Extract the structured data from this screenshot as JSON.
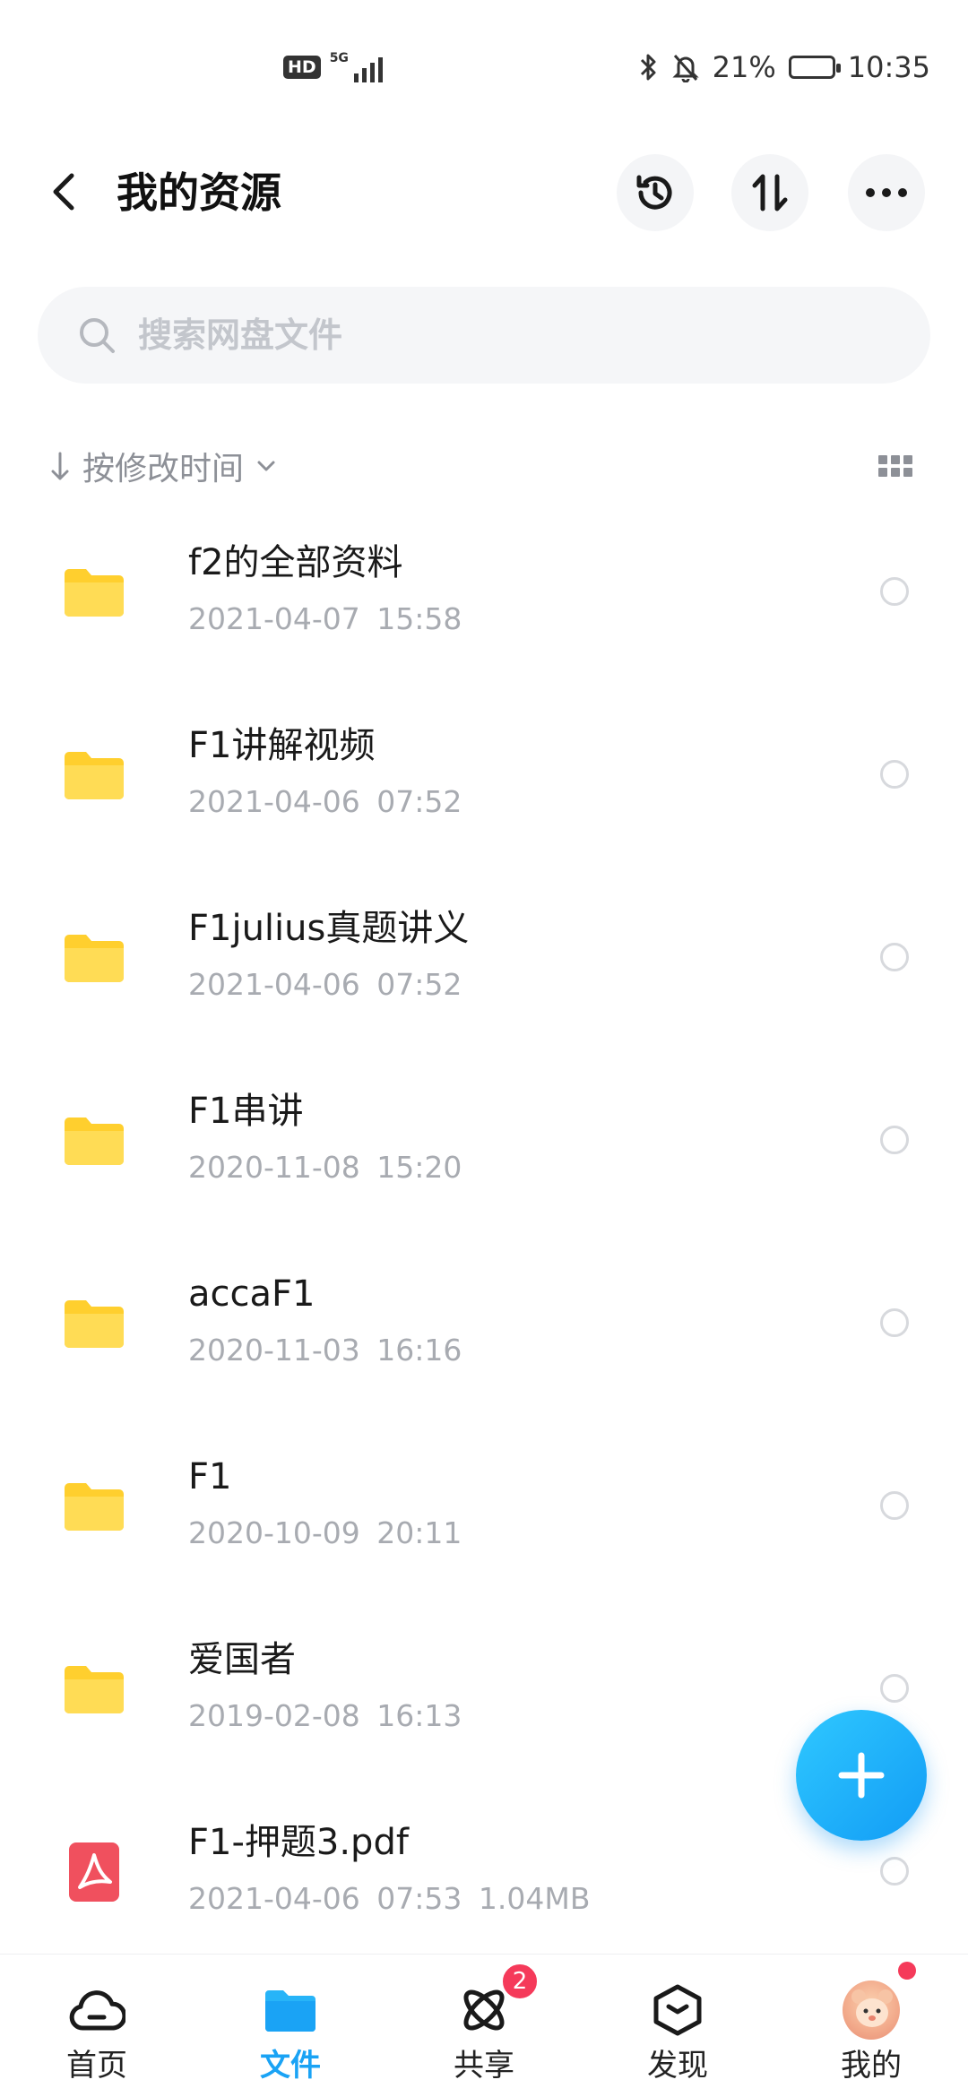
{
  "status_bar": {
    "hd": "HD",
    "network": "5G",
    "battery_percent": "21%",
    "battery_level": 0.21,
    "time": "10:35"
  },
  "header": {
    "title": "我的资源",
    "icons": [
      "back-icon",
      "history-icon",
      "sort-icon",
      "more-icon"
    ]
  },
  "search": {
    "placeholder": "搜索网盘文件"
  },
  "sort": {
    "label": "按修改时间"
  },
  "files": [
    {
      "name": "f2的全部资料",
      "date": "2021-04-07",
      "time": "15:58",
      "size": "",
      "type": "folder"
    },
    {
      "name": "F1讲解视频",
      "date": "2021-04-06",
      "time": "07:52",
      "size": "",
      "type": "folder"
    },
    {
      "name": "F1julius真题讲义",
      "date": "2021-04-06",
      "time": "07:52",
      "size": "",
      "type": "folder"
    },
    {
      "name": "F1串讲",
      "date": "2020-11-08",
      "time": "15:20",
      "size": "",
      "type": "folder"
    },
    {
      "name": "accaF1",
      "date": "2020-11-03",
      "time": "16:16",
      "size": "",
      "type": "folder"
    },
    {
      "name": "F1",
      "date": "2020-10-09",
      "time": "20:11",
      "size": "",
      "type": "folder"
    },
    {
      "name": "爱国者",
      "date": "2019-02-08",
      "time": "16:13",
      "size": "",
      "type": "folder"
    },
    {
      "name": "F1-押题3.pdf",
      "date": "2021-04-06",
      "time": "07:53",
      "size": "1.04MB",
      "type": "pdf"
    }
  ],
  "bottom_nav": [
    {
      "label": "首页",
      "icon": "cloud-home-icon",
      "active": false
    },
    {
      "label": "文件",
      "icon": "folder-icon",
      "active": true
    },
    {
      "label": "共享",
      "icon": "orbit-share-icon",
      "active": false,
      "badge": "2"
    },
    {
      "label": "发现",
      "icon": "discover-box-icon",
      "active": false
    },
    {
      "label": "我的",
      "icon": "avatar",
      "active": false,
      "dot": true
    }
  ],
  "colors": {
    "accent": "#1aa3f5",
    "folder": "#ffd43b",
    "pdf": "#f0505e",
    "badge": "#f53a5a"
  }
}
